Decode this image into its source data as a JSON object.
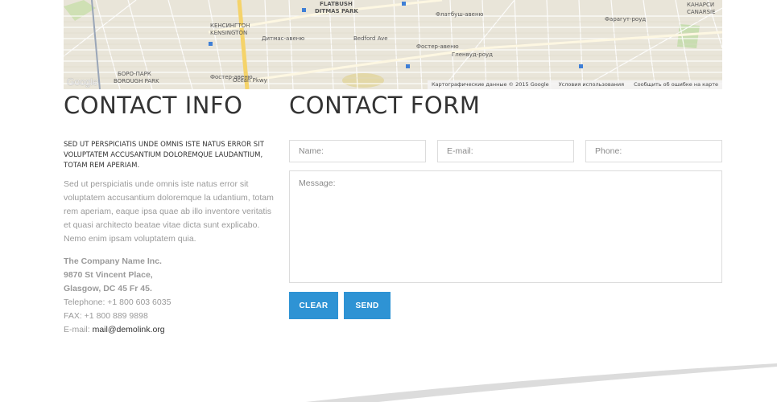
{
  "map": {
    "labels": [
      {
        "text": "Флатбуш-авеню",
        "cls": "l1"
      },
      {
        "text": "FLATBUSH",
        "cls": "l2"
      },
      {
        "text": "DITMAS PARK",
        "cls": "l3"
      },
      {
        "text": "КЕНСИНГТОН",
        "cls": "l4"
      },
      {
        "text": "KENSINGTON",
        "cls": "l5"
      },
      {
        "text": "Фостер-авеню",
        "cls": "l6"
      },
      {
        "text": "Гленвуд-роуд",
        "cls": "l7"
      },
      {
        "text": "БОРО-ПАРК",
        "cls": "l8"
      },
      {
        "text": "BOROUGH PARK",
        "cls": "l9"
      },
      {
        "text": "КАНАРСИ",
        "cls": "l10"
      },
      {
        "text": "CANARSIE",
        "cls": "l11"
      },
      {
        "text": "Фостер-авеню",
        "cls": "l12"
      },
      {
        "text": "Ocean Pkwy",
        "cls": "l13"
      },
      {
        "text": "Bedford Ave",
        "cls": "l14"
      },
      {
        "text": "Фарагут-роуд",
        "cls": "l15"
      },
      {
        "text": "Дитмас-авеню",
        "cls": "l16"
      }
    ],
    "attribution": {
      "data": "Картографические данные © 2015 Google",
      "terms": "Условия использования",
      "report": "Сообщить об ошибке на карте"
    },
    "logo": "Google"
  },
  "info": {
    "title": "CONTACT INFO",
    "lead": "Sed ut perspiciatis unde omnis iste natus error sit voluptatem accusantium doloremque laudantium, totam rem aperiam.",
    "body": "Sed ut perspiciatis unde omnis iste natus error sit voluptatem accusantium doloremque la udantium, totam rem aperiam, eaque ipsa quae ab illo inventore veritatis et quasi architecto beatae vitae dicta sunt explicabo. Nemo enim ipsam voluptatem quia.",
    "company": "The Company Name Inc.",
    "street": "9870 St Vincent Place,",
    "city": "Glasgow, DC 45 Fr 45.",
    "telephone": "Telephone: +1 800 603 6035",
    "fax": "FAX: +1 800 889 9898",
    "email_label": "E-mail: ",
    "email": "mail@demolink.org"
  },
  "form": {
    "title": "CONTACT FORM",
    "name_placeholder": "Name:",
    "email_placeholder": "E-mail:",
    "phone_placeholder": "Phone:",
    "message_placeholder": "Message:",
    "clear_label": "CLEAR",
    "send_label": "SEND",
    "accent_color": "#2e93d4"
  }
}
